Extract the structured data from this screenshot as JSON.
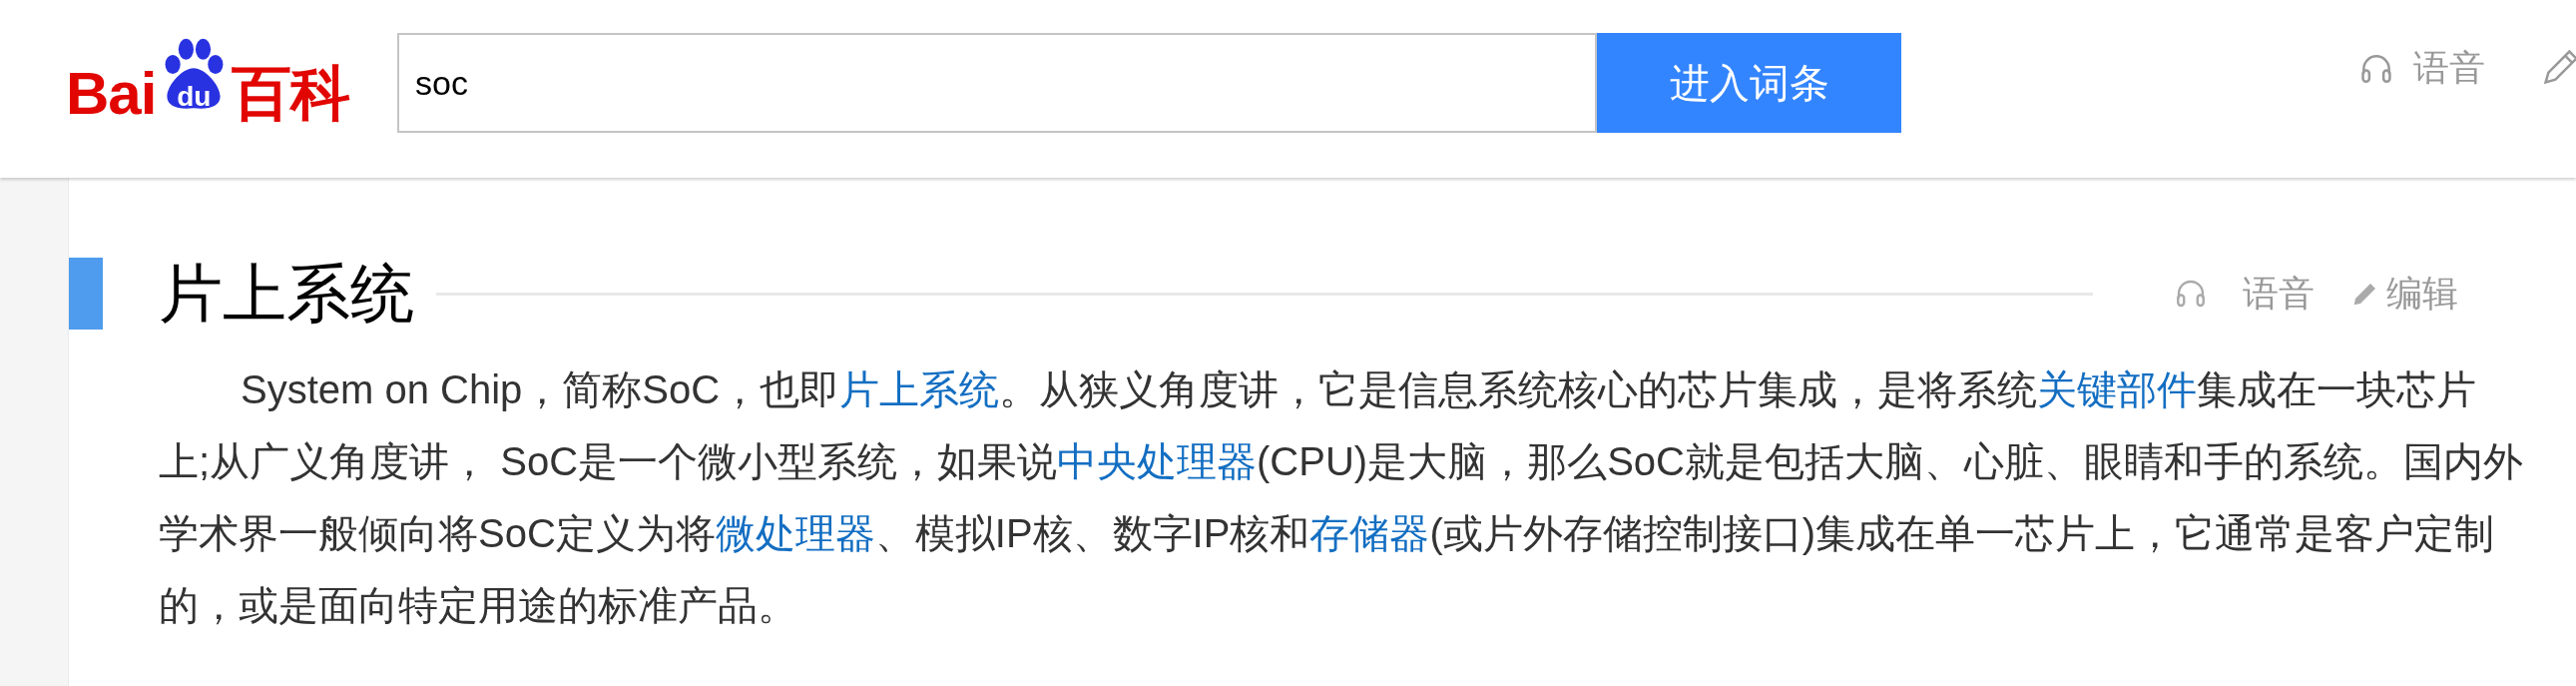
{
  "header": {
    "logo": {
      "left": "Bai",
      "mark": "du",
      "right": "百科"
    },
    "search": {
      "value": "soc"
    },
    "search_button": "进入词条",
    "voice_link": "语音"
  },
  "section": {
    "title": "片上系统",
    "voice_link": "语音",
    "edit_link": "编辑",
    "paragraph": [
      {
        "text": "System on Chip，简称SoC，也即",
        "link": false
      },
      {
        "text": "片上系统",
        "link": true
      },
      {
        "text": "。从狭义角度讲，它是信息系统核心的芯片集成，是将系统",
        "link": false
      },
      {
        "text": "关键部件",
        "link": true
      },
      {
        "text": "集成在一块芯片上;从广义角度讲， SoC是一个微小型系统，如果说",
        "link": false
      },
      {
        "text": "中央处理器",
        "link": true
      },
      {
        "text": "(CPU)是大脑，那么SoC就是包括大脑、心脏、眼睛和手的系统。国内外学术界一般倾向将SoC定义为将",
        "link": false
      },
      {
        "text": "微处理器",
        "link": true
      },
      {
        "text": "、模拟IP核、数字IP核和",
        "link": false
      },
      {
        "text": "存储器",
        "link": true
      },
      {
        "text": "(或片外存储控制接口)集成在单一芯片上，它通常是客户定制的，或是面向特定用途的标准产品。",
        "link": false
      }
    ]
  }
}
